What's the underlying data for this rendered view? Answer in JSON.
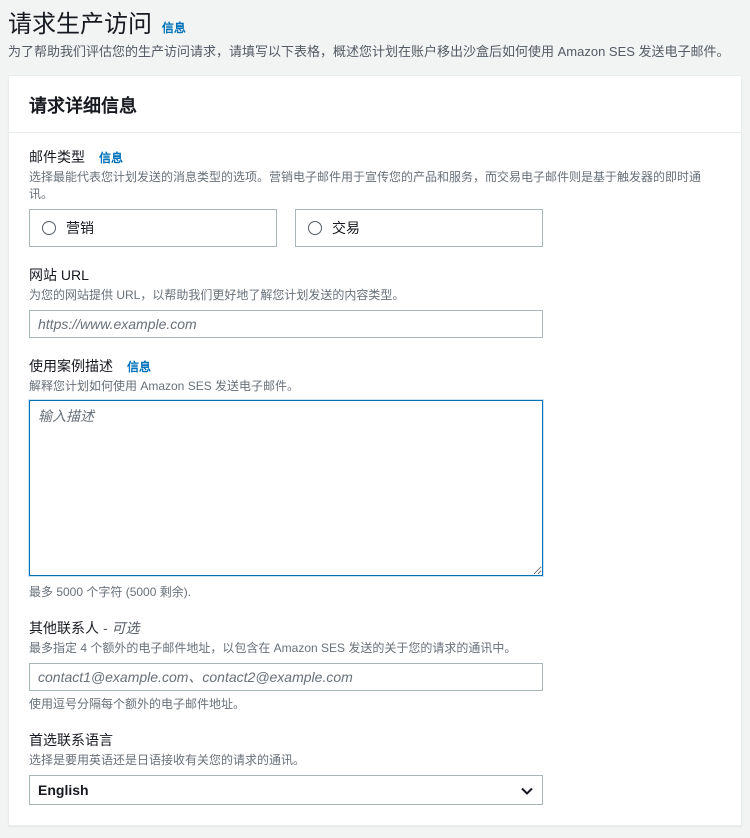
{
  "header": {
    "title": "请求生产访问",
    "infoLink": "信息",
    "subtitle": "为了帮助我们评估您的生产访问请求，请填写以下表格，概述您计划在账户移出沙盒后如何使用 Amazon SES 发送电子邮件。"
  },
  "card": {
    "title": "请求详细信息"
  },
  "mailType": {
    "label": "邮件类型",
    "infoLink": "信息",
    "hint": "选择最能代表您计划发送的消息类型的选项。营销电子邮件用于宣传您的产品和服务，而交易电子邮件则是基于触发器的即时通讯。",
    "options": [
      "营销",
      "交易"
    ]
  },
  "websiteUrl": {
    "label": "网站 URL",
    "hint": "为您的网站提供 URL，以帮助我们更好地了解您计划发送的内容类型。",
    "placeholder": "https://www.example.com"
  },
  "useCase": {
    "label": "使用案例描述",
    "infoLink": "信息",
    "hint": "解释您计划如何使用 Amazon SES 发送电子邮件。",
    "placeholder": "输入描述",
    "constraint": "最多 5000 个字符  (5000 剩余)."
  },
  "contacts": {
    "label": "其他联系人",
    "optional": "- 可选",
    "hint": "最多指定 4 个额外的电子邮件地址，以包含在 Amazon SES 发送的关于您的请求的通讯中。",
    "placeholder": "contact1@example.com、contact2@example.com",
    "after": "使用逗号分隔每个额外的电子邮件地址。"
  },
  "language": {
    "label": "首选联系语言",
    "hint": "选择是要用英语还是日语接收有关您的请求的通讯。",
    "value": "English"
  }
}
